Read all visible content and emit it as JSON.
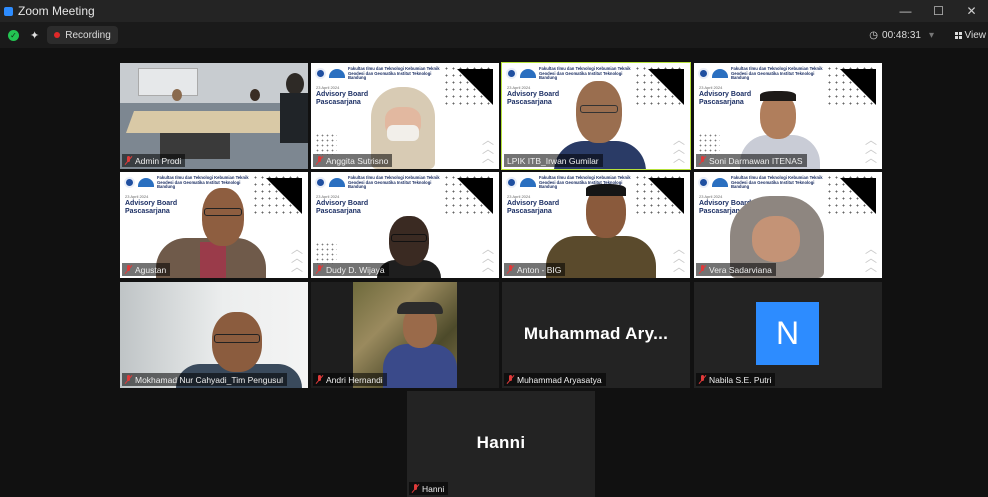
{
  "window": {
    "title": "Zoom Meeting",
    "controls": [
      "—",
      "☐",
      "✕"
    ]
  },
  "toolbar": {
    "recording_label": "Recording",
    "timer": "00:48:31",
    "view_label": "View"
  },
  "slide": {
    "header": "Fakultas Ilmu dan Teknologi Kebumian Teknik Geodesi dan Geomatika Institut Teknologi Bandung",
    "logo_text": "ASIIN",
    "date": "23 April 2024",
    "title": "Advisory Board Pascasarjana"
  },
  "participants": [
    {
      "name": "Admin Prodi"
    },
    {
      "name": "Anggita Sutrisno"
    },
    {
      "name": "LPIK ITB_Irwan Gumilar"
    },
    {
      "name": "Soni Darmawan ITENAS"
    },
    {
      "name": "Agustan"
    },
    {
      "name": "Dudy D. Wijaya"
    },
    {
      "name": "Anton - BIG"
    },
    {
      "name": "Vera Sadarviana"
    },
    {
      "name": "Mokhamad Nur Cahyadi_Tim Pengusul"
    },
    {
      "name": "Andri Hernandi"
    },
    {
      "name": "Muhammad Aryasatya",
      "display": "Muhammad  Ary..."
    },
    {
      "name": "Nabila S.E. Putri",
      "avatar_letter": "N"
    },
    {
      "name": "Hanni",
      "display": "Hanni"
    }
  ],
  "colors": {
    "active_speaker": "#b6e13a",
    "avatar": "#2d8cff",
    "mute": "#e03a3a"
  }
}
